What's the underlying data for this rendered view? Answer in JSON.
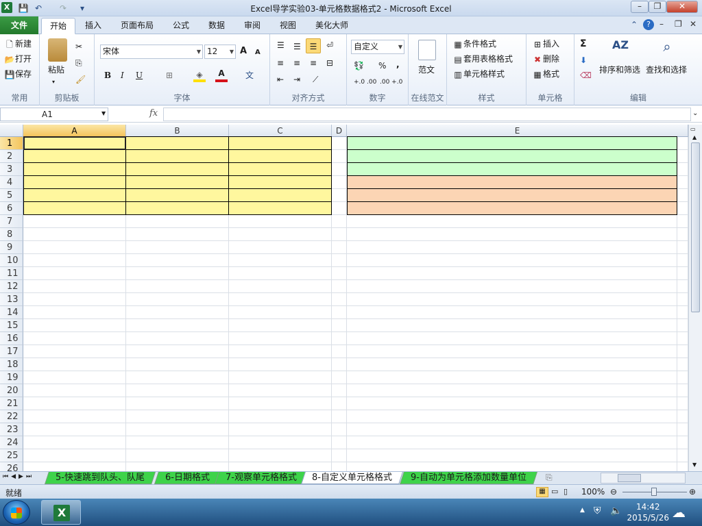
{
  "window": {
    "title": "Excel导学实验03-单元格数据格式2 - Microsoft Excel",
    "min_label": "–",
    "max_label": "❐",
    "close_label": "✕"
  },
  "quick_access": {
    "save": "💾",
    "undo": "↶",
    "redo": "↷",
    "customize": "▾"
  },
  "tabs": [
    "开始",
    "插入",
    "页面布局",
    "公式",
    "数据",
    "审阅",
    "视图",
    "美化大师"
  ],
  "file_tab": "文件",
  "active_tab_index": 0,
  "ribbon": {
    "common": {
      "label": "常用",
      "new": "新建",
      "open": "打开",
      "save": "保存"
    },
    "clipboard": {
      "label": "剪贴板",
      "paste": "粘贴"
    },
    "font": {
      "label": "字体",
      "name": "宋体",
      "size": "12",
      "bold": "B",
      "italic": "I",
      "underline": "U",
      "grow": "A",
      "shrink": "A"
    },
    "align": {
      "label": "对齐方式"
    },
    "number": {
      "label": "数字",
      "format": "自定义",
      "percent": "%",
      "comma": ",",
      "inc": "+.0 .00",
      "dec": ".00 +.0"
    },
    "template": {
      "label": "在线范文",
      "button": "范文"
    },
    "styles": {
      "label": "样式",
      "cond": "条件格式",
      "table": "套用表格格式",
      "cell": "单元格样式"
    },
    "cells": {
      "label": "单元格",
      "insert": "插入",
      "delete": "删除",
      "format": "格式"
    },
    "edit": {
      "label": "编辑",
      "sort": "排序和筛选",
      "find": "查找和选择",
      "sum": "Σ"
    }
  },
  "formula_bar": {
    "name_box": "A1",
    "fx": "fx",
    "formula": ""
  },
  "grid": {
    "columns": [
      "A",
      "B",
      "C",
      "D",
      "E"
    ],
    "selected_column": "A",
    "rows": [
      "1",
      "2",
      "3",
      "4",
      "5",
      "6",
      "7",
      "8",
      "9",
      "10",
      "11",
      "12",
      "13",
      "14",
      "15",
      "16",
      "17",
      "18",
      "19",
      "20",
      "21",
      "22",
      "23",
      "24",
      "25",
      "26"
    ],
    "selected_row": "1",
    "fill_colors": {
      "yellow": "#fff79e",
      "green": "#ccffcc",
      "orange": "#fcd5b4"
    }
  },
  "sheets": [
    "5-快速跳到队头、队尾",
    "6-日期格式",
    "7-观察单元格格式",
    "8-自定义单元格格式",
    "9-自动为单元格添加数量单位"
  ],
  "active_sheet_index": 3,
  "status": {
    "ready": "就绪",
    "zoom": "100%"
  },
  "taskbar": {
    "time": "14:42",
    "date": "2015/5/26"
  }
}
